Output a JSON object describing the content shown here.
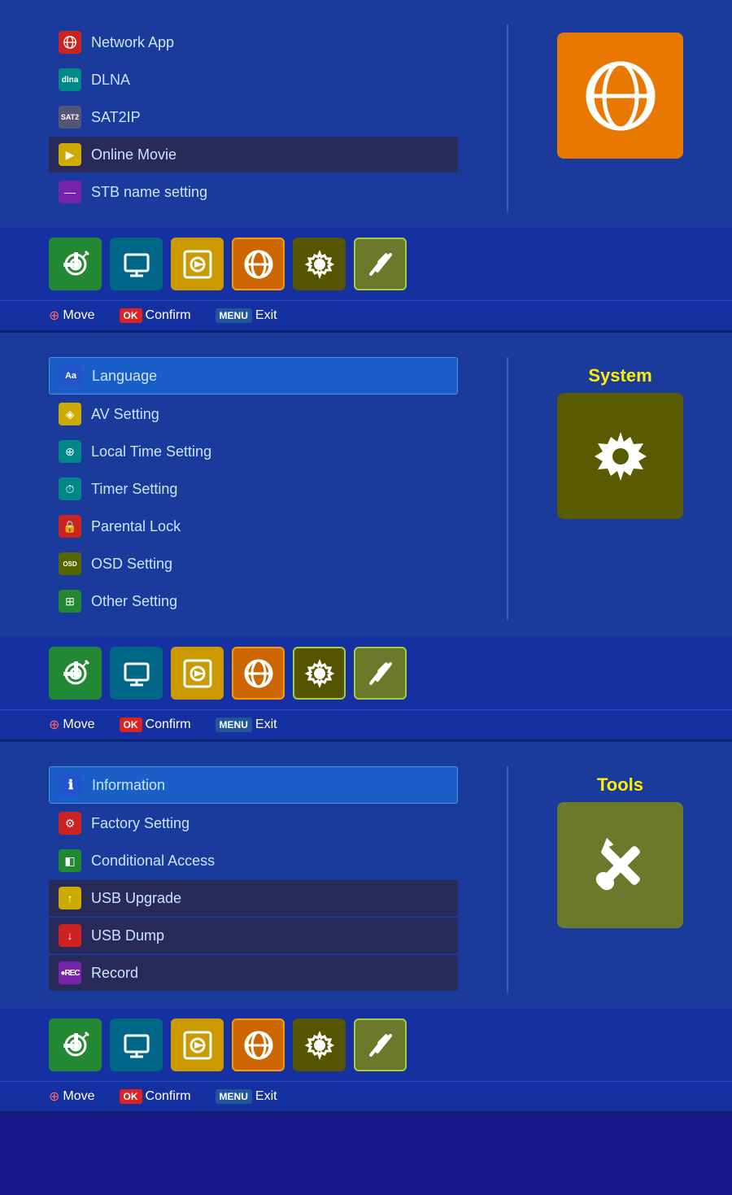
{
  "panels": [
    {
      "id": "network",
      "title": null,
      "icon_type": "globe",
      "icon_bg": "orange",
      "items": [
        {
          "label": "Network App",
          "icon_color": "icon-red",
          "icon_char": "🌐",
          "selected": false,
          "dark": false
        },
        {
          "label": "DLNA",
          "icon_color": "icon-teal",
          "icon_char": "D",
          "selected": false,
          "dark": false
        },
        {
          "label": "SAT2IP",
          "icon_color": "icon-gray",
          "icon_char": "S",
          "selected": false,
          "dark": false
        },
        {
          "label": "Online Movie",
          "icon_color": "icon-yellow",
          "icon_char": "▶",
          "selected": false,
          "dark": true
        },
        {
          "label": "STB name setting",
          "icon_color": "icon-purple",
          "icon_char": "—",
          "selected": false,
          "dark": false
        }
      ],
      "nav": {
        "move_label": "Move",
        "ok_label": "Confirm",
        "menu_label": "Exit"
      },
      "active_nav_icon": 3
    },
    {
      "id": "system",
      "title": "System",
      "icon_type": "gear",
      "icon_bg": "dark-olive",
      "items": [
        {
          "label": "Language",
          "icon_color": "icon-blue",
          "icon_char": "Aa",
          "selected": true,
          "dark": false
        },
        {
          "label": "AV Setting",
          "icon_color": "icon-yellow",
          "icon_char": "◈",
          "selected": false,
          "dark": false
        },
        {
          "label": "Local Time Setting",
          "icon_color": "icon-teal",
          "icon_char": "⊕",
          "selected": false,
          "dark": false
        },
        {
          "label": "Timer Setting",
          "icon_color": "icon-teal",
          "icon_char": "⏱",
          "selected": false,
          "dark": false
        },
        {
          "label": "Parental Lock",
          "icon_color": "icon-red",
          "icon_char": "🔒",
          "selected": false,
          "dark": false
        },
        {
          "label": "OSD Setting",
          "icon_color": "icon-olive",
          "icon_char": "osd",
          "selected": false,
          "dark": false
        },
        {
          "label": "Other Setting",
          "icon_color": "icon-green",
          "icon_char": "⊞",
          "selected": false,
          "dark": false
        }
      ],
      "nav": {
        "move_label": "Move",
        "ok_label": "Confirm",
        "menu_label": "Exit"
      },
      "active_nav_icon": 4
    },
    {
      "id": "tools",
      "title": "Tools",
      "icon_type": "tools",
      "icon_bg": "olive-green",
      "items": [
        {
          "label": "Information",
          "icon_color": "icon-blue",
          "icon_char": "ℹ",
          "selected": true,
          "dark": false
        },
        {
          "label": "Factory Setting",
          "icon_color": "icon-red",
          "icon_char": "⚙",
          "selected": false,
          "dark": false
        },
        {
          "label": "Conditional Access",
          "icon_color": "icon-green",
          "icon_char": "◧",
          "selected": false,
          "dark": false
        },
        {
          "label": "USB Upgrade",
          "icon_color": "icon-yellow",
          "icon_char": "↑",
          "selected": false,
          "dark": true
        },
        {
          "label": "USB Dump",
          "icon_color": "icon-red",
          "icon_char": "↓",
          "selected": false,
          "dark": true
        },
        {
          "label": "Record",
          "icon_color": "icon-purple",
          "icon_char": "●",
          "selected": false,
          "dark": true
        }
      ],
      "nav": {
        "move_label": "Move",
        "ok_label": "Confirm",
        "menu_label": "Exit"
      },
      "active_nav_icon": 5
    }
  ],
  "nav_icons": [
    {
      "type": "satellite",
      "bg": "green"
    },
    {
      "type": "tv",
      "bg": "teal"
    },
    {
      "type": "media",
      "bg": "yellow-nav"
    },
    {
      "type": "globe",
      "bg": "orange-nav"
    },
    {
      "type": "gear",
      "bg": "dark-olive"
    },
    {
      "type": "tools",
      "bg": "olive-green"
    }
  ]
}
